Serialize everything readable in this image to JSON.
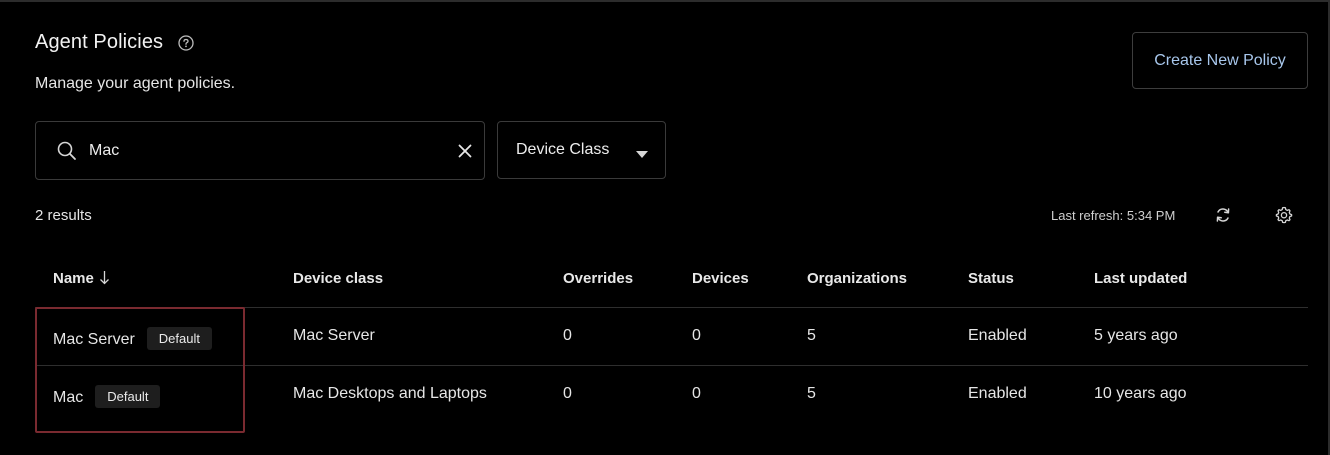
{
  "header": {
    "title": "Agent Policies",
    "subtitle": "Manage your agent policies.",
    "help_icon": "help-circle-icon",
    "create_button_label": "Create New Policy"
  },
  "filters": {
    "search_value": "Mac",
    "search_placeholder": "",
    "device_class_label": "Device Class"
  },
  "results": {
    "count_label": "2 results",
    "last_refresh": "Last refresh: 5:34 PM"
  },
  "table": {
    "columns": [
      "Name",
      "Device class",
      "Overrides",
      "Devices",
      "Organizations",
      "Status",
      "Last updated"
    ],
    "rows": [
      {
        "name": "Mac Server",
        "badge": "Default",
        "device_class": "Mac Server",
        "overrides": "0",
        "devices": "0",
        "organizations": "5",
        "status": "Enabled",
        "last_updated": "5 years ago"
      },
      {
        "name": "Mac",
        "badge": "Default",
        "device_class": "Mac Desktops and Laptops",
        "overrides": "0",
        "devices": "0",
        "organizations": "5",
        "status": "Enabled",
        "last_updated": "10 years ago"
      }
    ]
  },
  "colors": {
    "background": "#000000",
    "accent_link": "#a8c7ec",
    "highlight_border": "#7a2a30"
  }
}
